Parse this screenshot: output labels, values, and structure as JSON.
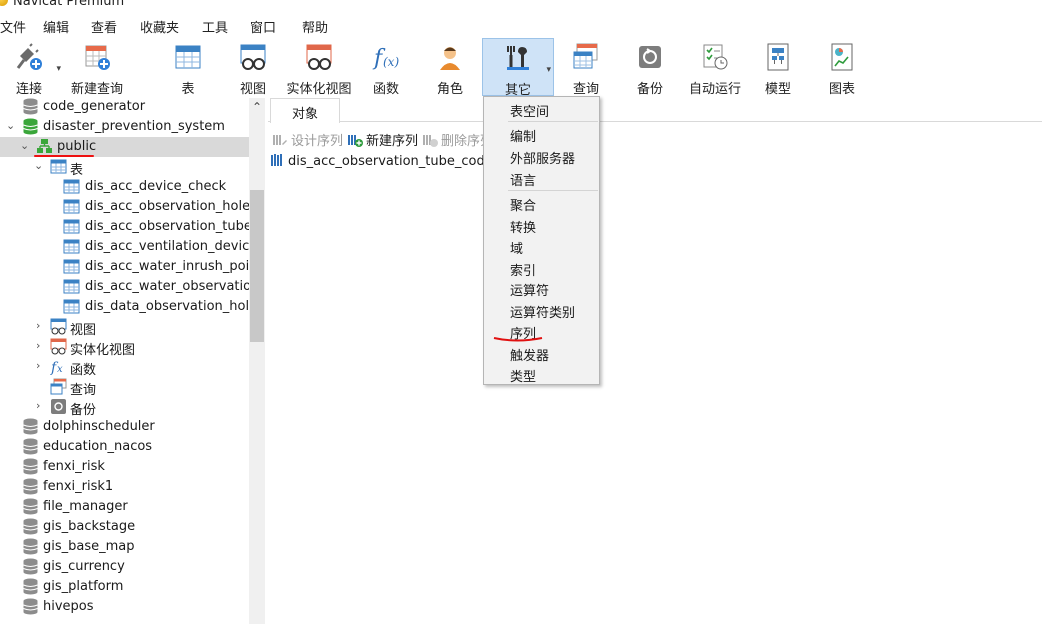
{
  "window": {
    "title": "Navicat Premium"
  },
  "menubar": [
    "文件",
    "编辑",
    "查看",
    "收藏夹",
    "工具",
    "窗口",
    "帮助"
  ],
  "toolbar": {
    "connect": "连接",
    "new_query": "新建查询",
    "table": "表",
    "view": "视图",
    "materialized_view": "实体化视图",
    "function": "函数",
    "role": "角色",
    "other": "其它",
    "query": "查询",
    "backup": "备份",
    "automation": "自动运行",
    "model": "模型",
    "chart": "图表"
  },
  "tree": {
    "db_code_generator": "code_generator",
    "db_disaster": "disaster_prevention_system",
    "schema_public": "public",
    "tables_folder": "表",
    "tables": [
      "dis_acc_device_check",
      "dis_acc_observation_hole",
      "dis_acc_observation_tube",
      "dis_acc_ventilation_device",
      "dis_acc_water_inrush_point",
      "dis_acc_water_observation_",
      "dis_data_observation_hole"
    ],
    "views_folder": "视图",
    "matviews_folder": "实体化视图",
    "functions_folder": "函数",
    "queries_folder": "查询",
    "backups_folder": "备份",
    "other_dbs": [
      "dolphinscheduler",
      "education_nacos",
      "fenxi_risk",
      "fenxi_risk1",
      "file_manager",
      "gis_backstage",
      "gis_base_map",
      "gis_currency",
      "gis_platform",
      "hivepos"
    ]
  },
  "content": {
    "tab_label": "对象",
    "design_sequence": "设计序列",
    "new_sequence": "新建序列",
    "delete_sequence": "删除序列",
    "object_item": "dis_acc_observation_tube_code_seq"
  },
  "dropdown": {
    "items": [
      "表空间",
      "编制",
      "外部服务器",
      "语言",
      "聚合",
      "转换",
      "域",
      "索引",
      "运算符",
      "运算符类别",
      "序列",
      "触发器",
      "类型"
    ]
  },
  "colors": {
    "annotation_red": "#e11111",
    "selected_tool": "#cfe3f7",
    "db_green": "#3aa63a"
  }
}
